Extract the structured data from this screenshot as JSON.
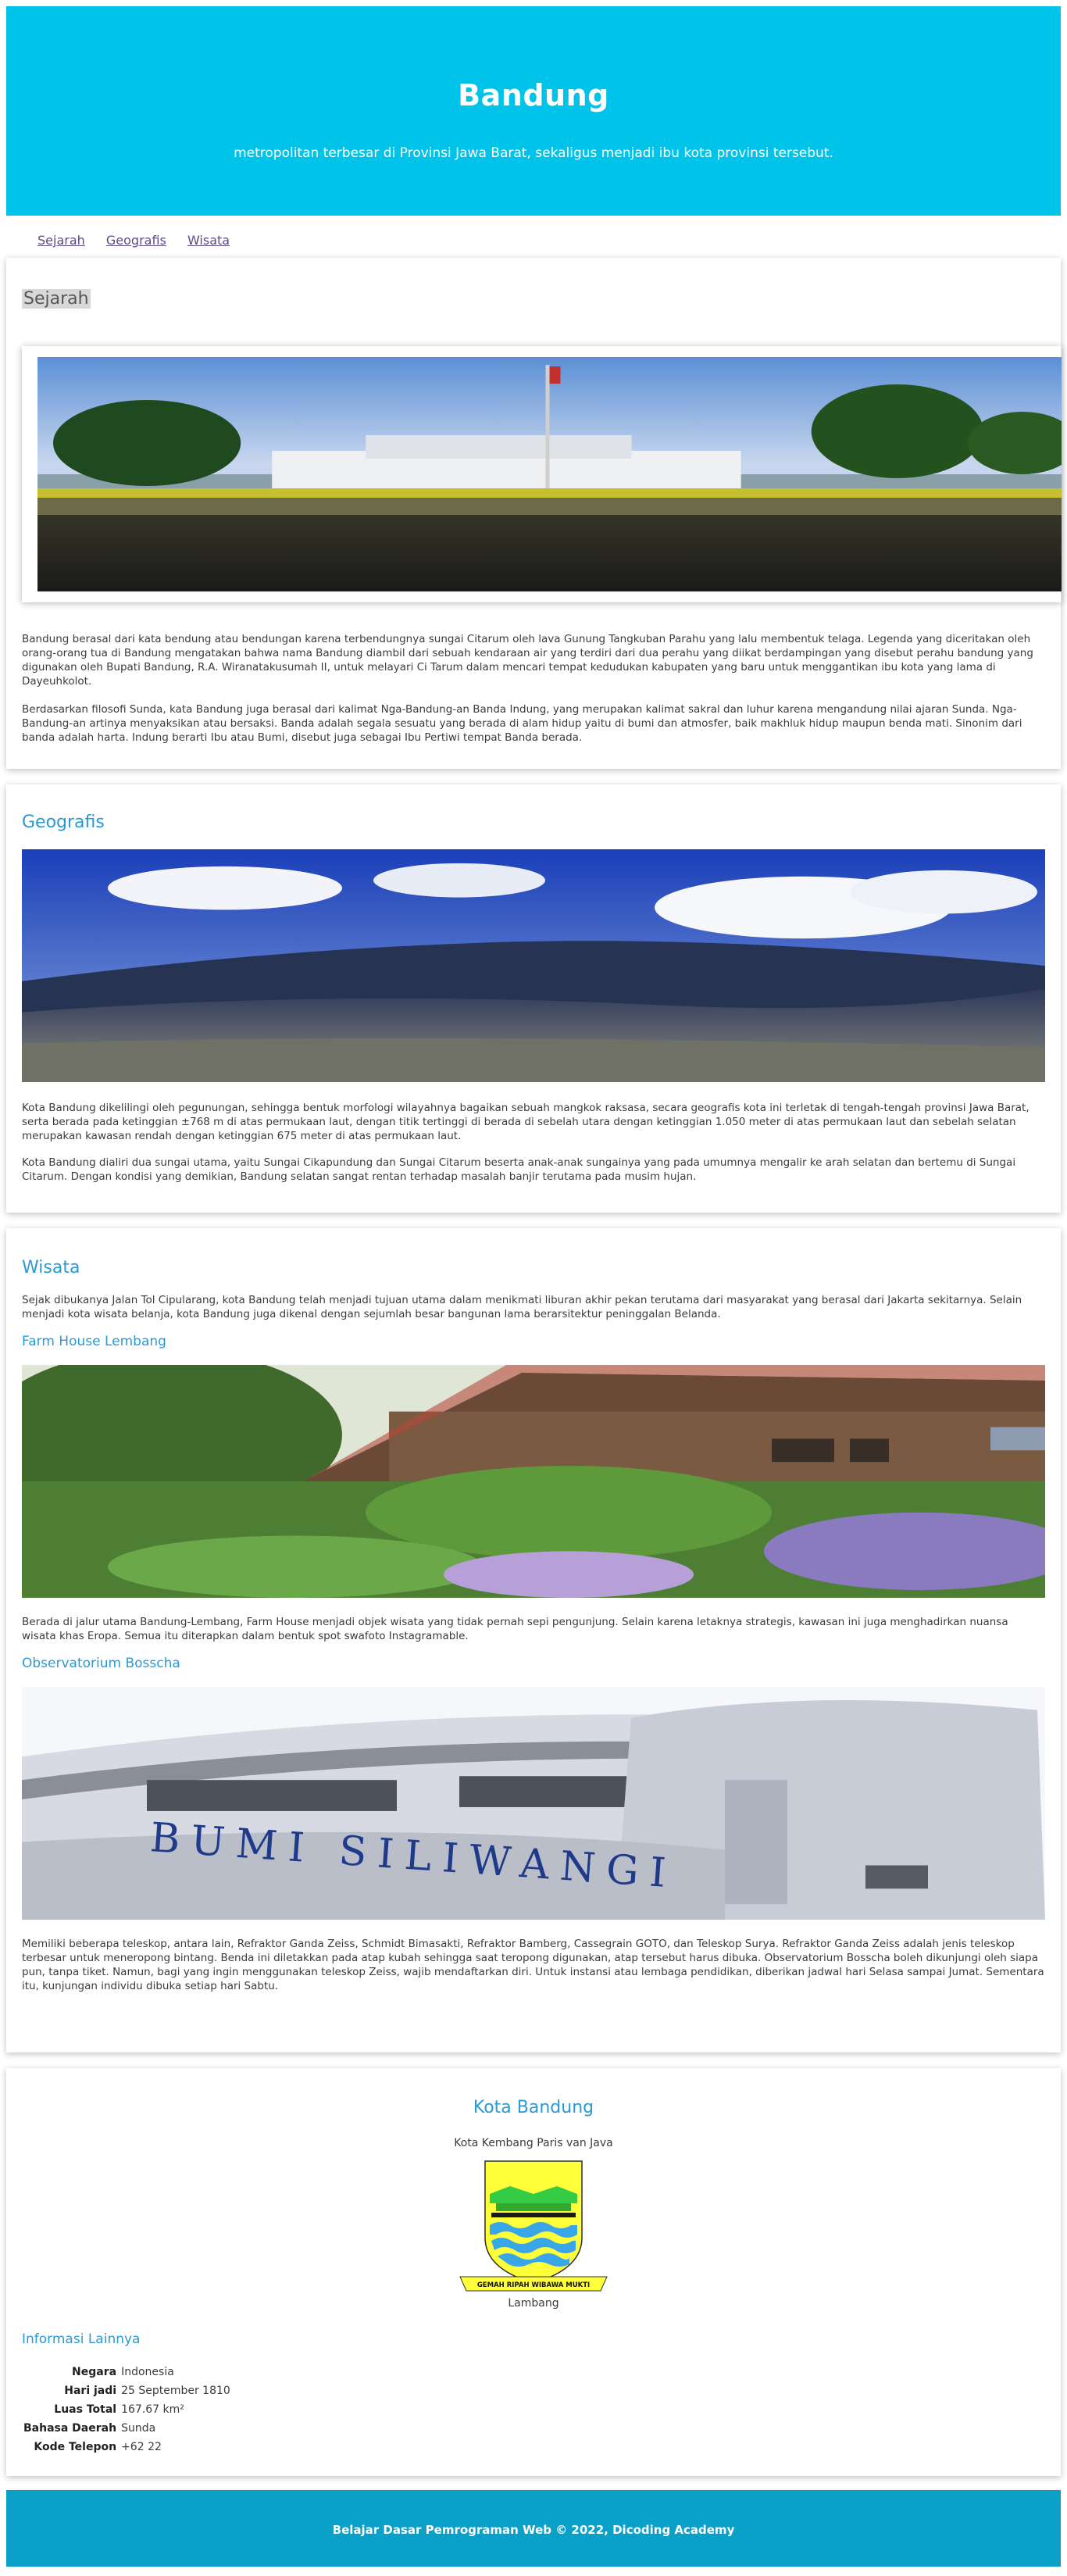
{
  "header": {
    "title": "Bandung",
    "subtitle": "metropolitan terbesar di Provinsi Jawa Barat, sekaligus menjadi ibu kota provinsi tersebut."
  },
  "nav": {
    "items": [
      "Sejarah",
      "Geografis",
      "Wisata"
    ]
  },
  "sejarah": {
    "title": "Sejarah",
    "p1": "Bandung berasal dari kata bendung atau bendungan karena terbendungnya sungai Citarum oleh lava Gunung Tangkuban Parahu yang lalu membentuk telaga. Legenda yang diceritakan oleh orang-orang tua di Bandung mengatakan bahwa nama Bandung diambil dari sebuah kendaraan air yang terdiri dari dua perahu yang diikat berdampingan yang disebut perahu bandung yang digunakan oleh Bupati Bandung, R.A. Wiranatakusumah II, untuk melayari Ci Tarum dalam mencari tempat kedudukan kabupaten yang baru untuk menggantikan ibu kota yang lama di Dayeuhkolot.",
    "p2": "Berdasarkan filosofi Sunda, kata Bandung juga berasal dari kalimat Nga-Bandung-an Banda Indung, yang merupakan kalimat sakral dan luhur karena mengandung nilai ajaran Sunda. Nga-Bandung-an artinya menyaksikan atau bersaksi. Banda adalah segala sesuatu yang berada di alam hidup yaitu di bumi dan atmosfer, baik makhluk hidup maupun benda mati. Sinonim dari banda adalah harta. Indung berarti Ibu atau Bumi, disebut juga sebagai Ibu Pertiwi tempat Banda berada."
  },
  "geografis": {
    "title": "Geografis",
    "p1": "Kota Bandung dikelilingi oleh pegunungan, sehingga bentuk morfologi wilayahnya bagaikan sebuah mangkok raksasa, secara geografis kota ini terletak di tengah-tengah provinsi Jawa Barat, serta berada pada ketinggian ±768 m di atas permukaan laut, dengan titik tertinggi di berada di sebelah utara dengan ketinggian 1.050 meter di atas permukaan laut dan sebelah selatan merupakan kawasan rendah dengan ketinggian 675 meter di atas permukaan laut.",
    "p2": "Kota Bandung dialiri dua sungai utama, yaitu Sungai Cikapundung dan Sungai Citarum beserta anak-anak sungainya yang pada umumnya mengalir ke arah selatan dan bertemu di Sungai Citarum. Dengan kondisi yang demikian, Bandung selatan sangat rentan terhadap masalah banjir terutama pada musim hujan."
  },
  "wisata": {
    "title": "Wisata",
    "intro": "Sejak dibukanya Jalan Tol Cipularang, kota Bandung telah menjadi tujuan utama dalam menikmati liburan akhir pekan terutama dari masyarakat yang berasal dari Jakarta sekitarnya. Selain menjadi kota wisata belanja, kota Bandung juga dikenal dengan sejumlah besar bangunan lama berarsitektur peninggalan Belanda.",
    "farm_title": "Farm House Lembang",
    "farm_text": "Berada di jalur utama Bandung-Lembang, Farm House menjadi objek wisata yang tidak pernah sepi pengunjung. Selain karena letaknya strategis, kawasan ini juga menghadirkan nuansa wisata khas Eropa. Semua itu diterapkan dalam bentuk spot swafoto Instagramable.",
    "obs_title": "Observatorium Bosscha",
    "obs_sign": "BUMI SILIWANGI",
    "obs_text": "Memiliki beberapa teleskop, antara lain, Refraktor Ganda Zeiss, Schmidt Bimasakti, Refraktor Bamberg, Cassegrain GOTO, dan Teleskop Surya. Refraktor Ganda Zeiss adalah jenis teleskop terbesar untuk meneropong bintang. Benda ini diletakkan pada atap kubah sehingga saat teropong digunakan, atap tersebut harus dibuka. Observatorium Bosscha boleh dikunjungi oleh siapa pun, tanpa tiket. Namun, bagi yang ingin menggunakan teleskop Zeiss, wajib mendaftarkan diri. Untuk instansi atau lembaga pendidikan, diberikan jadwal hari Selasa sampai Jumat. Sementara itu, kunjungan individu dibuka setiap hari Sabtu."
  },
  "aside": {
    "title": "Kota Bandung",
    "tagline": "Kota Kembang Paris van Java",
    "emblem_motto": "GEMAH RIPAH WIBAWA MUKTI",
    "emblem_caption": "Lambang",
    "info_title": "Informasi Lainnya",
    "rows": [
      {
        "key": "Negara",
        "value": "Indonesia"
      },
      {
        "key": "Hari jadi",
        "value": "25 September 1810"
      },
      {
        "key": "Luas Total",
        "value": "167.67 km²"
      },
      {
        "key": "Bahasa Daerah",
        "value": "Sunda"
      },
      {
        "key": "Kode Telepon",
        "value": "+62 22"
      }
    ]
  },
  "footer": {
    "text": "Belajar Dasar Pemrograman Web © 2022, Dicoding Academy"
  },
  "colors": {
    "header_bg": "#00c3ea",
    "footer_bg": "#0aa0c8",
    "heading": "#2a9ad6",
    "nav_link": "#5b4a86"
  }
}
